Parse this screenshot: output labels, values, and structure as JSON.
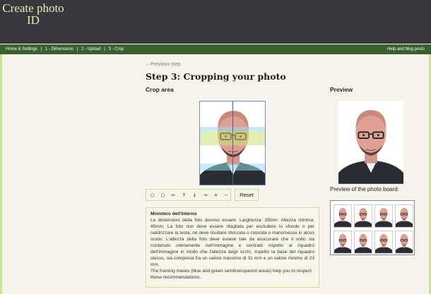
{
  "header": {
    "logo_line1": "Create photo",
    "logo_line2": "ID"
  },
  "nav": {
    "items": [
      "Home & Settings",
      "|",
      "1 - Dimensions",
      "|",
      "2 - Upload",
      "|",
      "3 - Crop"
    ],
    "right_link": "Help and blog posts"
  },
  "content": {
    "previous_step": "←Previous step",
    "title": "Step 3: Cropping your photo",
    "crop_heading": "Crop area",
    "preview_heading": "Preview",
    "board_label": "Preview of the photo board:"
  },
  "toolbar": {
    "buttons": [
      {
        "label": "○",
        "name": "rotate-ccw-icon"
      },
      {
        "label": "○",
        "name": "rotate-cw-icon"
      },
      {
        "label": "←",
        "name": "arrow-left-icon"
      },
      {
        "label": "↑",
        "name": "arrow-up-icon"
      },
      {
        "label": "↓",
        "name": "arrow-down-icon"
      },
      {
        "label": "→",
        "name": "arrow-right-icon"
      },
      {
        "label": "+",
        "name": "zoom-in-icon"
      },
      {
        "label": "−",
        "name": "zoom-out-icon"
      }
    ],
    "reset_label": "Reset"
  },
  "info": {
    "title": "Ministero dell'Interno",
    "text": "Le dimensioni della foto devono essere: Larghezza: 35mm. Altezza minima: 45mm. La foto non deve essere ritagliata per escludere lo sfondo o per raddrizzare la testa, né deve risultare ritoccata o colorata o manomessa in alcun modo. L'altezza della foto deve essere tale da assicurare che il volto sia contenuto interamente nell'immagine e centrato rispetto al riquadro dell'immagine in modo che l'altezza degli occhi, rispetto la base del riquadro stesso, sia compresa fra un valore massimo di 31 mm e un valore minimo di 23 mm.",
    "note": "The framing masks (blue and green semitransparent areas) help you to respect these recommendations."
  },
  "colors": {
    "header_bg": "#36383d",
    "nav_bg": "#39612e",
    "logo_text": "#f1e9b0",
    "frame_border": "#c7e196",
    "mask_blue": "#96dcf0",
    "mask_green": "#c8e178"
  }
}
